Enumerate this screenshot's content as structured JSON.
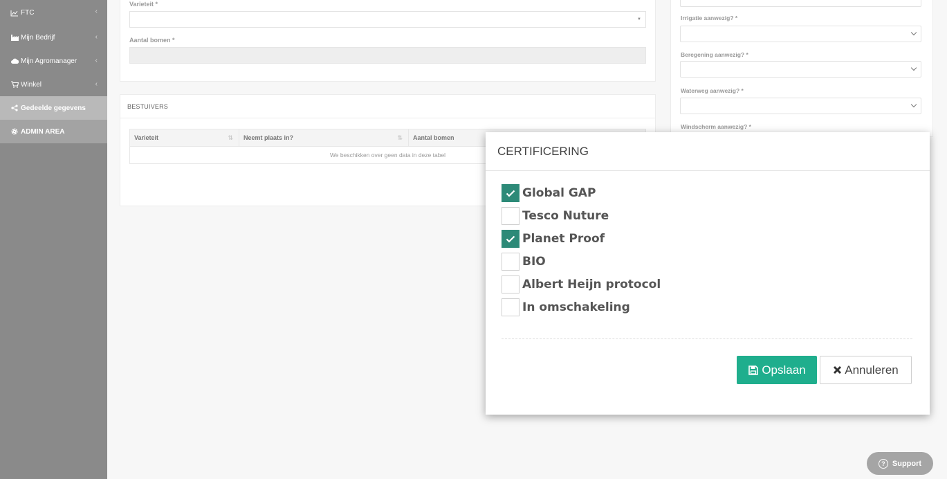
{
  "sidebar": {
    "items": [
      {
        "label": "FTC",
        "icon": "chart-line-icon"
      },
      {
        "label": "Mijn Bedrijf",
        "icon": "industry-icon"
      },
      {
        "label": "Mijn Agromanager",
        "icon": "cloud-icon"
      },
      {
        "label": "Winkel",
        "icon": "cart-icon"
      },
      {
        "label": "Gedeelde gegevens",
        "icon": "share-icon"
      },
      {
        "label": "ADMIN AREA",
        "icon": "gear-icon"
      }
    ]
  },
  "form": {
    "variety_label": "Varieteit *",
    "trees_label": "Aantal bomen *"
  },
  "pollinators": {
    "title": "BESTUIVERS",
    "columns": [
      "Varieteit",
      "Neemt plaats in?",
      "Aantal bomen"
    ],
    "empty_text": "We beschikken over geen data in deze tabel"
  },
  "right": {
    "fields": [
      {
        "label": "Irrigatie aanwezig? *"
      },
      {
        "label": "Beregening aanwezig? *"
      },
      {
        "label": "Waterweg aanwezig? *"
      },
      {
        "label": "Windscherm aanwezig? *"
      }
    ]
  },
  "modal": {
    "title": "CERTIFICERING",
    "options": [
      {
        "label": "Global GAP",
        "checked": true
      },
      {
        "label": "Tesco Nuture",
        "checked": false
      },
      {
        "label": "Planet Proof",
        "checked": true
      },
      {
        "label": "BIO",
        "checked": false
      },
      {
        "label": "Albert Heijn protocol",
        "checked": false
      },
      {
        "label": "In omschakeling",
        "checked": false
      }
    ],
    "save_label": "Opslaan",
    "cancel_label": "Annuleren"
  },
  "support": {
    "label": "Support"
  },
  "colors": {
    "accent": "#1fae8d",
    "checkbox_on": "#2d8a78",
    "sidebar": "#8a8a8a"
  }
}
